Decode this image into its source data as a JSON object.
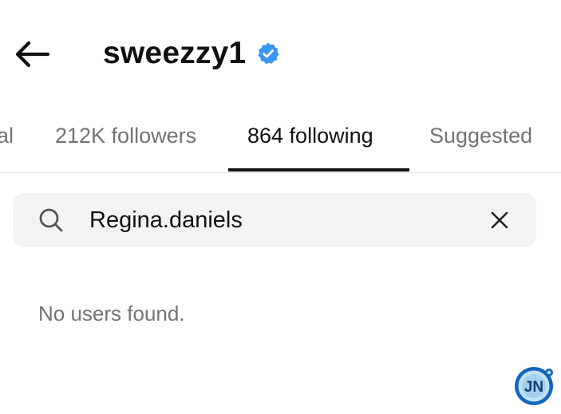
{
  "header": {
    "username": "sweezzy1",
    "back_icon": "arrow-left-icon",
    "verified_icon": "verified-badge-icon",
    "verified_color": "#3897f0"
  },
  "tabs": [
    {
      "label": "al",
      "active": false
    },
    {
      "label": "212K followers",
      "active": false
    },
    {
      "label": "864 following",
      "active": true
    },
    {
      "label": "Suggested",
      "active": false
    }
  ],
  "search": {
    "value": "Regina.daniels",
    "search_icon": "search-icon",
    "clear_icon": "close-icon"
  },
  "results": {
    "empty_message": "No users found."
  },
  "watermark": {
    "text": "JN",
    "colors": {
      "ring": "#1565c0",
      "fill": "#bfe3f5"
    }
  }
}
